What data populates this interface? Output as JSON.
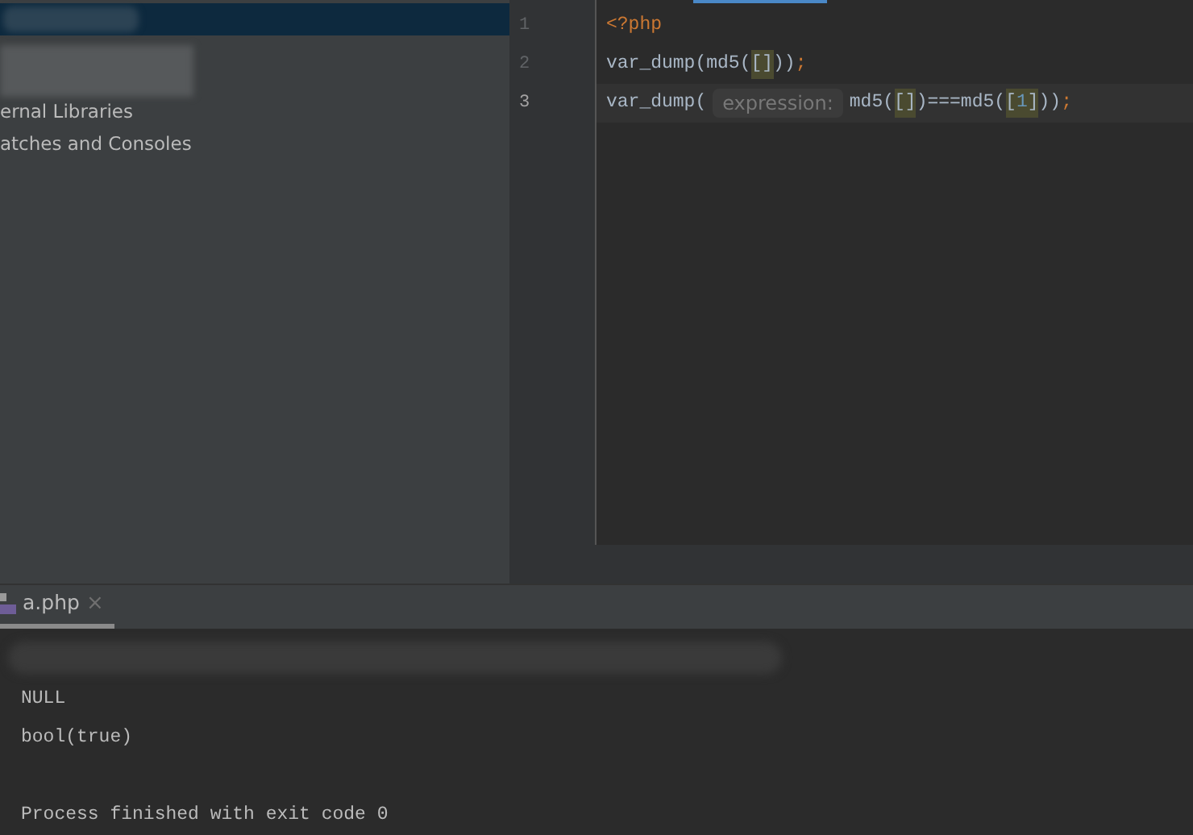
{
  "project_tree": {
    "items": [
      {
        "label": "ernal Libraries",
        "selected": false
      },
      {
        "label": "atches and Consoles",
        "selected": false
      }
    ]
  },
  "editor": {
    "lines": [
      {
        "number": "1",
        "current": false,
        "tokens": [
          {
            "text": "<?php",
            "kind": "tag",
            "matched": false
          }
        ]
      },
      {
        "number": "2",
        "current": false,
        "tokens": [
          {
            "text": "var_dump(md5(",
            "kind": "plain",
            "matched": false
          },
          {
            "text": "[]",
            "kind": "plain",
            "matched": true
          },
          {
            "text": "))",
            "kind": "plain",
            "matched": false
          },
          {
            "text": ";",
            "kind": "punct",
            "matched": false
          }
        ]
      },
      {
        "number": "3",
        "current": true,
        "tokens": [
          {
            "text": "var_dump(",
            "kind": "plain",
            "matched": false
          },
          {
            "text": "expression:",
            "kind": "hint",
            "matched": false
          },
          {
            "text": "md5(",
            "kind": "plain",
            "matched": false
          },
          {
            "text": "[]",
            "kind": "plain",
            "matched": true
          },
          {
            "text": ")===md5(",
            "kind": "plain",
            "matched": false
          },
          {
            "text": "[",
            "kind": "plain",
            "matched": true
          },
          {
            "text": "1",
            "kind": "number",
            "matched": true
          },
          {
            "text": "]",
            "kind": "plain",
            "matched": true
          },
          {
            "text": "))",
            "kind": "plain",
            "matched": false
          },
          {
            "text": ";",
            "kind": "punct",
            "matched": false
          }
        ]
      }
    ]
  },
  "run_panel": {
    "tabs": [
      {
        "label": "a.php",
        "selected": true,
        "close": "×"
      }
    ],
    "output": [
      "NULL",
      "bool(true)"
    ],
    "exit_message": "Process finished with exit code 0"
  }
}
